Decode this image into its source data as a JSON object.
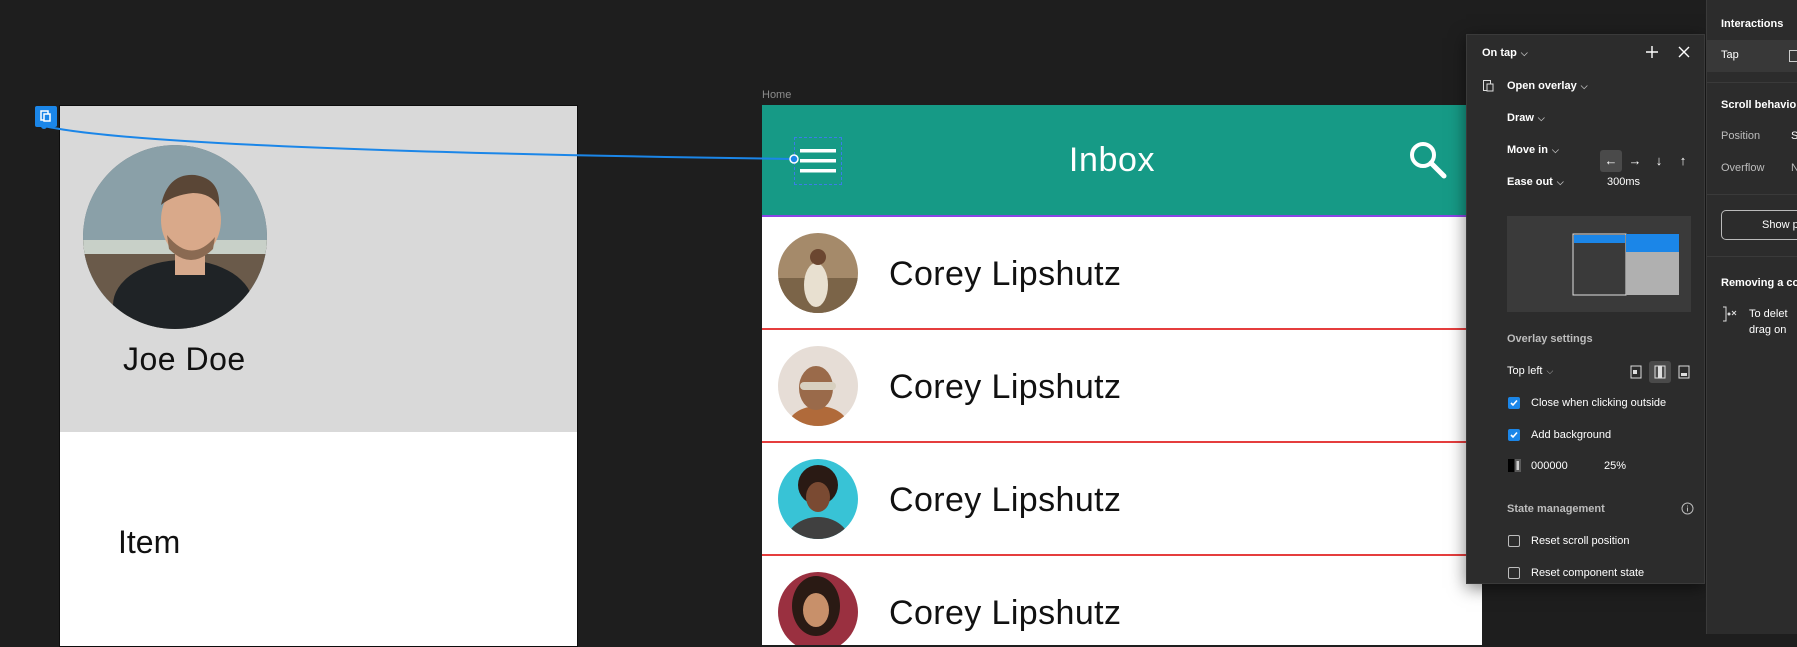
{
  "drawer": {
    "name": "Joe Doe",
    "item": "Item"
  },
  "home": {
    "frame_label": "Home",
    "title": "Inbox",
    "messages": [
      {
        "name": "Corey Lipshutz"
      },
      {
        "name": "Corey Lipshutz"
      },
      {
        "name": "Corey Lipshutz"
      },
      {
        "name": "Corey Lipshutz"
      }
    ]
  },
  "popover": {
    "trigger": "On tap",
    "action": "Open overlay",
    "overlay_target": "Draw",
    "animation": "Move in",
    "easing": "Ease out",
    "duration": "300ms",
    "overlay_settings_heading": "Overlay settings",
    "position": "Top left",
    "close_outside_label": "Close when clicking outside",
    "close_outside_checked": true,
    "add_background_label": "Add background",
    "add_background_checked": true,
    "bg_color": "000000",
    "bg_opacity": "25%",
    "state_heading": "State management",
    "reset_scroll_label": "Reset scroll position",
    "reset_scroll_checked": false,
    "reset_component_label": "Reset component state",
    "reset_component_checked": false,
    "directions": [
      "←",
      "→",
      "↓",
      "↑"
    ]
  },
  "right_panel": {
    "interactions_heading": "Interactions",
    "tap_label": "Tap",
    "scroll_heading": "Scroll behavio",
    "position_label": "Position",
    "position_value": "S",
    "overflow_label": "Overflow",
    "overflow_value": "N",
    "show_button": "Show p",
    "removing_heading": "Removing a co",
    "removing_text_1": "To delet",
    "removing_text_2": "drag on"
  },
  "colors": {
    "canvas": "#1e1e1e",
    "appbar": "#169a86",
    "accent_blue": "#1b86e8",
    "row_divider": "#e53e3e",
    "frame_outline": "#8a45e6"
  }
}
